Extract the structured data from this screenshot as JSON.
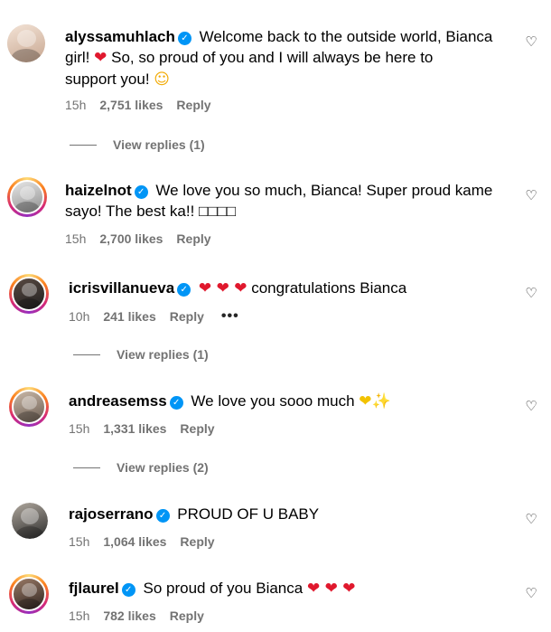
{
  "comments": [
    {
      "username": "alyssamuhlach",
      "text_lines": [
        "Welcome back to the outside world, Bianca",
        "girl!",
        "So, so proud of you and I will always be here to",
        "support you!"
      ],
      "emojis": {
        "heart": "❤",
        "face": "☺"
      },
      "time": "15h",
      "likes": "2,751 likes",
      "reply": "Reply",
      "view_replies": "View replies (1)"
    },
    {
      "username": "haizelnot",
      "text_lines": [
        "We love you so much, Bianca! Super proud kame",
        "sayo! The best ka!! □□□□"
      ],
      "time": "15h",
      "likes": "2,700 likes",
      "reply": "Reply"
    },
    {
      "username": "icrisvillanueva",
      "text": "congratulations Bianca",
      "emojis": {
        "hearts": "❤ ❤ ❤"
      },
      "time": "10h",
      "likes": "241 likes",
      "reply": "Reply",
      "more": "•••",
      "view_replies": "View replies (1)"
    },
    {
      "username": "andreasemss",
      "text": "We love you sooo much",
      "emojis": {
        "yellow_heart": "❤",
        "sparkles": "✨"
      },
      "time": "15h",
      "likes": "1,331 likes",
      "reply": "Reply",
      "view_replies": "View replies (2)"
    },
    {
      "username": "rajoserrano",
      "text": "PROUD OF U BABY",
      "time": "15h",
      "likes": "1,064 likes",
      "reply": "Reply"
    },
    {
      "username": "fjlaurel",
      "text": "So proud of you Bianca",
      "emojis": {
        "hearts": "❤ ❤ ❤"
      },
      "time": "15h",
      "likes": "782 likes",
      "reply": "Reply"
    }
  ],
  "icons": {
    "like": "heart-outline-icon",
    "verified": "verified-badge-icon"
  },
  "colors": {
    "verified": "#0095f6",
    "meta_text": "#737373",
    "heart": "#e0182d"
  }
}
